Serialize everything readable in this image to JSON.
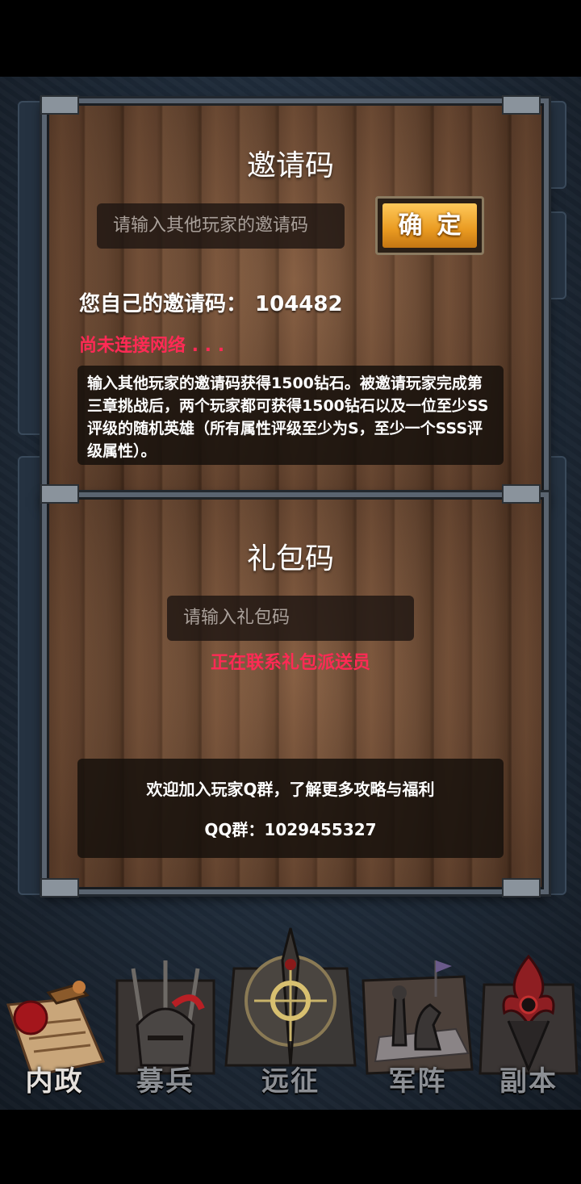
{
  "invite": {
    "title": "邀请码",
    "input_placeholder": "请输入其他玩家的邀请码",
    "confirm_label": "确定",
    "own_code_label": "您自己的邀请码：",
    "own_code_value": "104482",
    "network_status": "尚未连接网络 . . .",
    "description": "输入其他玩家的邀请码获得1500钻石。被邀请玩家完成第三章挑战后，两个玩家都可获得1500钻石以及一位至少SS评级的随机英雄（所有属性评级至少为S，至少一个SSS评级属性）。"
  },
  "gift": {
    "title": "礼包码",
    "input_placeholder": "请输入礼包码",
    "status": "正在联系礼包派送员",
    "qq_line1": "欢迎加入玩家Q群，了解更多攻略与福利",
    "qq_line2": "QQ群：1029455327"
  },
  "nav": {
    "items": [
      {
        "label": "内政",
        "icon": "scroll-seal-icon"
      },
      {
        "label": "募兵",
        "icon": "knight-helmet-icon"
      },
      {
        "label": "远征",
        "icon": "sword-emblem-icon"
      },
      {
        "label": "军阵",
        "icon": "chess-pieces-icon"
      },
      {
        "label": "副本",
        "icon": "dark-flame-icon"
      }
    ]
  }
}
